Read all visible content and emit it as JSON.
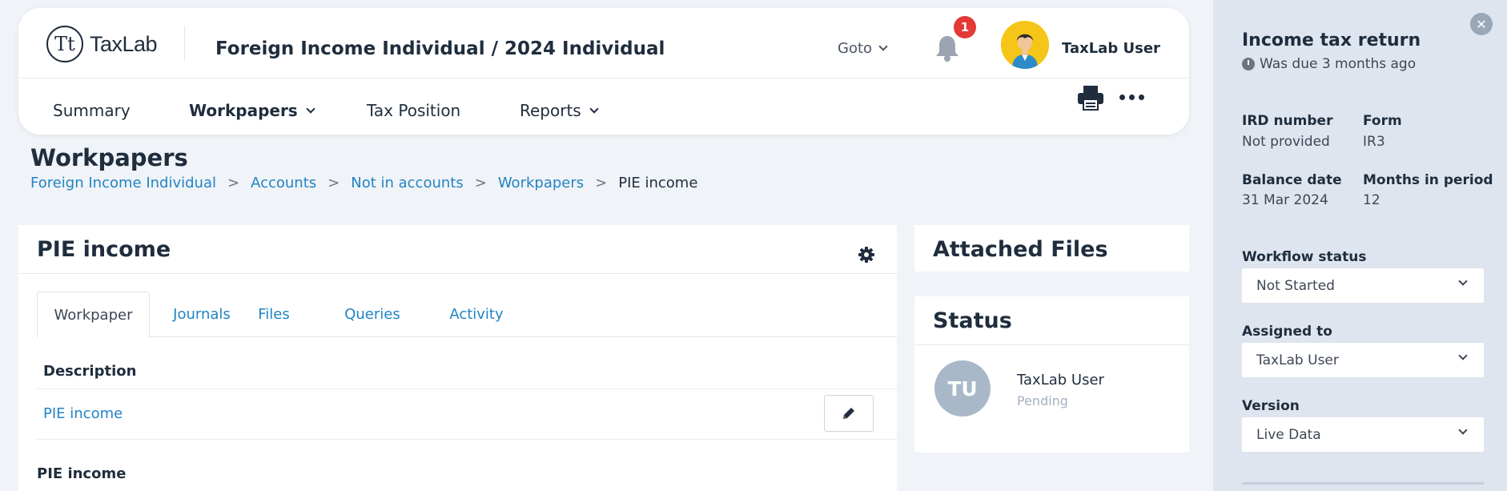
{
  "header": {
    "logo_text": "TaxLab",
    "logo_glyph": "Tt",
    "app_title": "Foreign Income Individual / 2024 Individual",
    "goto_label": "Goto",
    "notification_count": "1",
    "user_name": "TaxLab User"
  },
  "nav": {
    "items": [
      {
        "label": "Summary"
      },
      {
        "label": "Workpapers"
      },
      {
        "label": "Tax Position"
      },
      {
        "label": "Reports"
      }
    ]
  },
  "page": {
    "title": "Workpapers",
    "breadcrumb": [
      "Foreign Income Individual",
      "Accounts",
      "Not in accounts",
      "Workpapers",
      "PIE income"
    ],
    "separator": ">"
  },
  "workpaper_card": {
    "title": "PIE income",
    "tabs": [
      "Workpaper",
      "Journals",
      "Files",
      "Queries",
      "Activity"
    ],
    "description_heading": "Description",
    "description_value": "PIE income",
    "section_heading": "PIE income"
  },
  "attached_files": {
    "title": "Attached Files"
  },
  "status_card": {
    "title": "Status",
    "initials": "TU",
    "user_name": "TaxLab User",
    "state": "Pending"
  },
  "sidebar": {
    "title": "Income tax return",
    "due_text": "Was due 3 months ago",
    "ird_label": "IRD number",
    "ird_value": "Not provided",
    "form_label": "Form",
    "form_value": "IR3",
    "balance_label": "Balance date",
    "balance_value": "31 Mar 2024",
    "months_label": "Months in period",
    "months_value": "12",
    "workflow_label": "Workflow status",
    "workflow_value": "Not Started",
    "assigned_label": "Assigned to",
    "assigned_value": "TaxLab User",
    "version_label": "Version",
    "version_value": "Live Data"
  },
  "colors": {
    "link": "#2184c4",
    "text": "#1f2d3d",
    "badge": "#e53935",
    "avatar_bg": "#f5c518",
    "sidebar_bg": "#dfe5ee"
  }
}
